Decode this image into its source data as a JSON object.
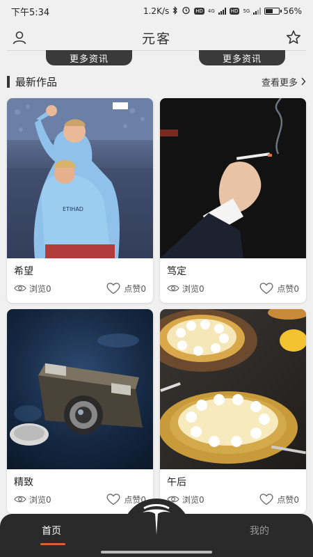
{
  "status": {
    "time": "下午5:34",
    "speed": "1.2K/s",
    "battery": "56%",
    "battery_level": 0.56,
    "net1": "4G",
    "net2": "5G"
  },
  "nav": {
    "title": "元客",
    "left_icon": "user-icon",
    "right_icon": "star-icon"
  },
  "pills": {
    "left": "更多资讯",
    "right": "更多资讯"
  },
  "section": {
    "title": "最新作品",
    "more": "查看更多"
  },
  "cards": [
    {
      "title": "希望",
      "views_label": "浏览0",
      "likes_label": "点赞0",
      "image": "football-players-photo"
    },
    {
      "title": "笃定",
      "views_label": "浏览0",
      "likes_label": "点赞0",
      "image": "hand-with-cigarette-photo"
    },
    {
      "title": "精致",
      "views_label": "浏览0",
      "likes_label": "点赞0",
      "image": "vintage-camera-photo"
    },
    {
      "title": "午后",
      "views_label": "浏览0",
      "likes_label": "点赞0",
      "image": "lemon-tarts-photo"
    }
  ],
  "tabs": {
    "home": "首页",
    "mine": "我的"
  },
  "colors": {
    "accent": "#d9642a",
    "tab_bg": "#2a2a2a",
    "pill_bg": "#3a3a3a"
  }
}
